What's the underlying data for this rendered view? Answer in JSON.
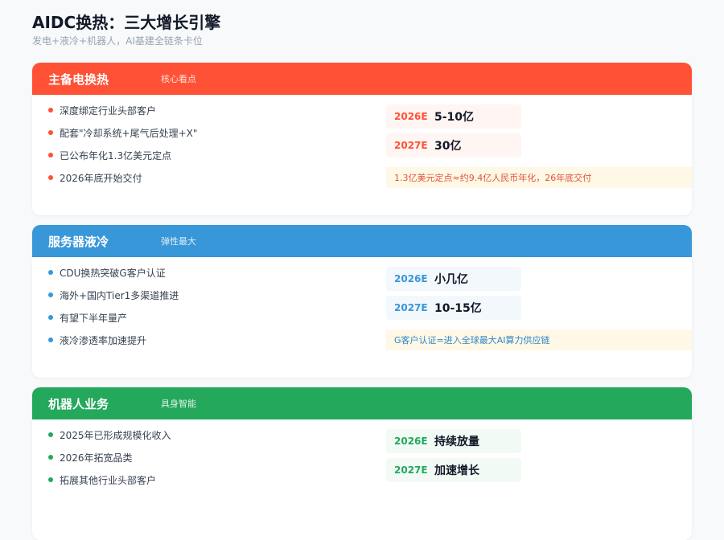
{
  "header": {
    "title": "AIDC换热：三大增长引擎",
    "subtitle": "发电+液冷+机器人，AI基建全链条卡位"
  },
  "colors": {
    "primary": "#ff5135",
    "server": "#3897d8",
    "robot": "#23a85c"
  },
  "sections": [
    {
      "title": "主备电换热",
      "tag": "核心看点",
      "bullets": [
        "深度绑定行业头部客户",
        "配套\"冷却系统+尾气后处理+X\"",
        "已公布年化1.3亿美元定点",
        "2026年底开始交付"
      ],
      "metrics": [
        {
          "year": "2026E",
          "value": "5-10亿"
        },
        {
          "year": "2027E",
          "value": "30亿"
        }
      ],
      "note": "1.3亿美元定点≈约9.4亿人民币年化，26年底交付"
    },
    {
      "title": "服务器液冷",
      "tag": "弹性最大",
      "bullets": [
        "CDU换热突破G客户认证",
        "海外+国内Tier1多渠道推进",
        "有望下半年量产",
        "液冷渗透率加速提升"
      ],
      "metrics": [
        {
          "year": "2026E",
          "value": "小几亿"
        },
        {
          "year": "2027E",
          "value": "10-15亿"
        }
      ],
      "note": "G客户认证=进入全球最大AI算力供应链"
    },
    {
      "title": "机器人业务",
      "tag": "具身智能",
      "bullets": [
        "2025年已形成规模化收入",
        "2026年拓宽品类",
        "拓展其他行业头部客户"
      ],
      "metrics": [
        {
          "year": "2026E",
          "value": "持续放量"
        },
        {
          "year": "2027E",
          "value": "加速增长"
        }
      ]
    }
  ]
}
